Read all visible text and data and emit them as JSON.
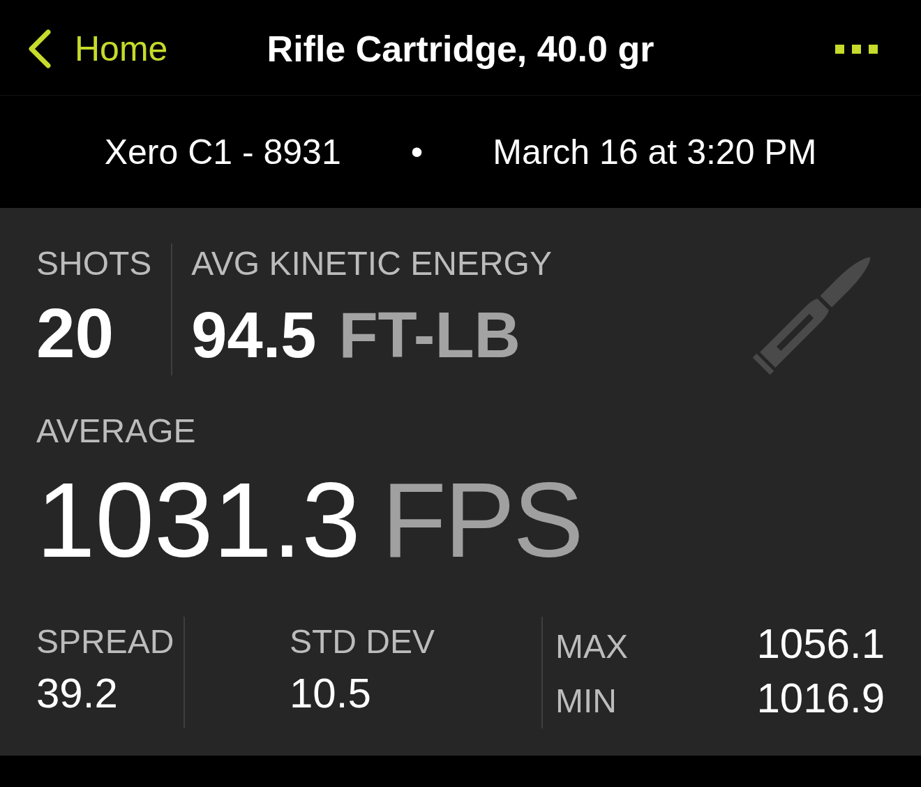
{
  "nav": {
    "back_label": "Home",
    "title": "Rifle Cartridge, 40.0 gr"
  },
  "session": {
    "device": "Xero C1 - 8931",
    "separator": "•",
    "date": "March 16 at 3:20 PM"
  },
  "summary": {
    "shots": {
      "label": "SHOTS",
      "value": "20"
    },
    "energy": {
      "label": "AVG KINETIC ENERGY",
      "value": "94.5",
      "unit": "FT-LB"
    }
  },
  "average": {
    "label": "AVERAGE",
    "value": "1031.3",
    "unit": "FPS"
  },
  "stats": [
    {
      "label": "SPREAD",
      "value": "39.2"
    },
    {
      "label": "STD DEV",
      "value": "10.5"
    }
  ],
  "range": [
    {
      "label": "MAX",
      "value": "1056.1"
    },
    {
      "label": "MIN",
      "value": "1016.9"
    }
  ]
}
